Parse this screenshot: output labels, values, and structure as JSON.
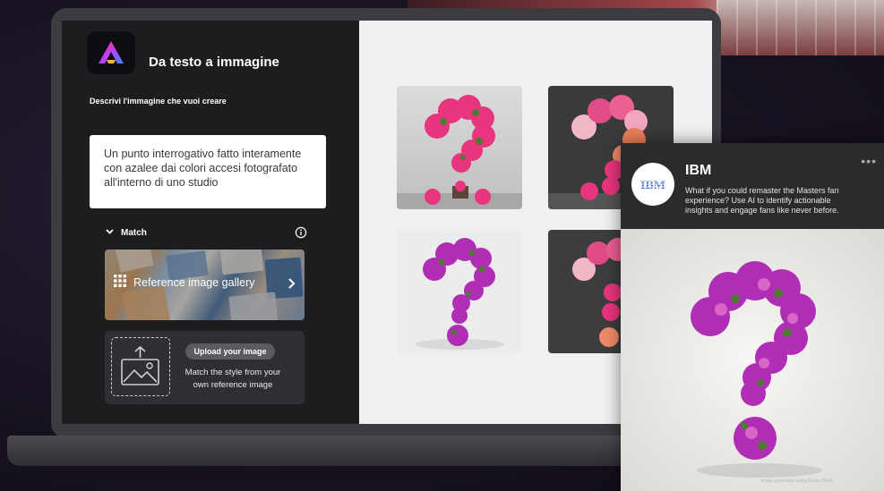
{
  "app": {
    "title": "Da testo a immagine"
  },
  "prompt": {
    "label": "Descrivi l'immagine che vuoi creare",
    "lines": [
      "Un punto interrogativo fatto interamente",
      "con azalee dai colori accesi fotografato",
      "all'interno di uno studio"
    ]
  },
  "match": {
    "label": "Match",
    "gallery_label": "Reference image gallery",
    "upload_button": "Upload your image",
    "upload_desc_lines": [
      "Match the style from your",
      "own reference image"
    ]
  },
  "popup": {
    "company": "IBM",
    "logo_text": "IBM",
    "message": "What if you could remaster the Masters fan experience? Use AI to identify actionable insights and engage fans like never before.",
    "dots": "•••",
    "credit": "Image generated using Adobe Firefly"
  },
  "icons": {
    "app_logo": "adobe-express-logo",
    "match_chevron": "chevron-down-icon",
    "info": "info-icon",
    "grid": "grid-icon",
    "chevron_right": "chevron-right-icon",
    "upload": "image-upload-icon"
  },
  "colors": {
    "flower_pink": "#e0337a",
    "flower_magenta": "#b02eb5",
    "leaf_green": "#4f7a32",
    "panel_dark": "#1d1d1f",
    "panel_light": "#f1f1f1"
  }
}
